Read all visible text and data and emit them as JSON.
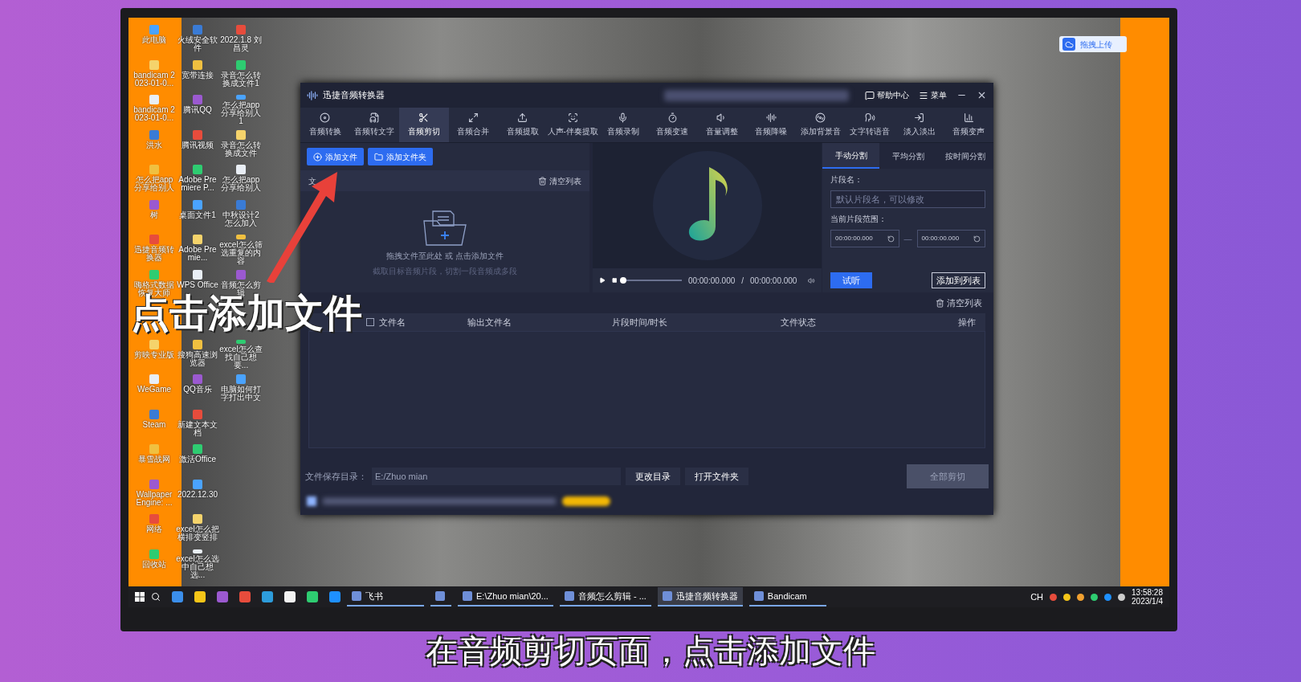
{
  "desktop": {
    "icon_columns": [
      [
        {
          "kind": "icon",
          "label": "此电脑"
        },
        {
          "kind": "icon",
          "label": "bandicam 2023-01-0..."
        },
        {
          "kind": "icon",
          "label": "bandicam 2023-01-0..."
        },
        {
          "kind": "icon",
          "label": "洪水"
        },
        {
          "kind": "icon",
          "label": "怎么把app分享给别人"
        },
        {
          "kind": "icon",
          "label": "树"
        },
        {
          "kind": "icon",
          "label": "迅捷音频转换器"
        },
        {
          "kind": "icon",
          "label": "嗨格式数据恢复大师"
        },
        {
          "kind": "covered"
        },
        {
          "kind": "icon",
          "label": "剪映专业版"
        },
        {
          "kind": "icon",
          "label": "WeGame"
        },
        {
          "kind": "icon",
          "label": "Steam"
        },
        {
          "kind": "icon",
          "label": "暴雪战网"
        },
        {
          "kind": "icon",
          "label": "Wallpaper Engine: ..."
        },
        {
          "kind": "icon",
          "label": "网络"
        },
        {
          "kind": "icon",
          "label": "回收站"
        }
      ],
      [
        {
          "kind": "icon",
          "label": "火绒安全软件"
        },
        {
          "kind": "icon",
          "label": "宽带连接"
        },
        {
          "kind": "icon",
          "label": "腾讯QQ"
        },
        {
          "kind": "icon",
          "label": "腾讯视频"
        },
        {
          "kind": "icon",
          "label": "Adobe Premiere P..."
        },
        {
          "kind": "icon",
          "label": "桌面文件1"
        },
        {
          "kind": "icon",
          "label": "Adobe Premie..."
        },
        {
          "kind": "icon",
          "label": "WPS Office"
        },
        {
          "kind": "covered"
        },
        {
          "kind": "icon",
          "label": "搜狗高速浏览器"
        },
        {
          "kind": "icon",
          "label": "QQ音乐"
        },
        {
          "kind": "icon",
          "label": "新建文本文档"
        },
        {
          "kind": "icon",
          "label": "激活Office"
        },
        {
          "kind": "icon",
          "label": "2022.12.30"
        },
        {
          "kind": "icon",
          "label": "excel怎么把横排变竖排"
        },
        {
          "kind": "icon",
          "label": "excel怎么选中自己想选..."
        }
      ],
      [
        {
          "kind": "icon",
          "label": "2022.1.8 刘昌灵"
        },
        {
          "kind": "icon",
          "label": "录音怎么转换成文件1"
        },
        {
          "kind": "icon",
          "label": "怎么把app分享给别人1"
        },
        {
          "kind": "icon",
          "label": "录音怎么转换成文件"
        },
        {
          "kind": "icon",
          "label": "怎么把app分享给别人"
        },
        {
          "kind": "icon",
          "label": "中秋设计2怎么加入"
        },
        {
          "kind": "icon",
          "label": "excel怎么筛选重复的内容"
        },
        {
          "kind": "icon",
          "label": "音频怎么剪辑"
        },
        {
          "kind": "covered"
        },
        {
          "kind": "icon",
          "label": "excel怎么查找自己想要..."
        },
        {
          "kind": "icon",
          "label": "电脑如何打字打出中文"
        }
      ]
    ]
  },
  "upload_button": {
    "label": "拖拽上传"
  },
  "app_window": {
    "title": "迅捷音频转换器",
    "help": "帮助中心",
    "menu": "菜单",
    "tools": [
      {
        "label": "音频转换",
        "selected": false
      },
      {
        "label": "音频转文字",
        "selected": false
      },
      {
        "label": "音频剪切",
        "selected": true
      },
      {
        "label": "音频合并",
        "selected": false
      },
      {
        "label": "音频提取",
        "selected": false
      },
      {
        "label": "人声-伴奏提取",
        "selected": false
      },
      {
        "label": "音频录制",
        "selected": false
      },
      {
        "label": "音频变速",
        "selected": false
      },
      {
        "label": "音量调整",
        "selected": false
      },
      {
        "label": "音频降噪",
        "selected": false
      },
      {
        "label": "添加背景音",
        "selected": false
      },
      {
        "label": "文字转语音",
        "selected": false
      },
      {
        "label": "淡入淡出",
        "selected": false
      },
      {
        "label": "音频变声",
        "selected": false
      }
    ],
    "add_file": "添加文件",
    "add_folder": "添加文件夹",
    "file_list_header": "文",
    "clear_list": "清空列表",
    "drop_hint": "拖拽文件至此处 或 点击添加文件",
    "drop_subhint": "截取目标音频片段，切割一段音频成多段",
    "player": {
      "level": 0,
      "current": "00:00:00.000",
      "separator": "/",
      "total": "00:00:00.000",
      "preview": "试听",
      "add_to_list": "添加到列表"
    },
    "split_tabs": [
      {
        "label": "手动分割",
        "selected": true
      },
      {
        "label": "平均分割",
        "selected": false
      },
      {
        "label": "按时间分割",
        "selected": false
      }
    ],
    "segment_name_label": "片段名：",
    "segment_name_placeholder": "默认片段名，可以修改",
    "range_label": "当前片段范围：",
    "range_start": "00:00:00.000",
    "range_dash": "—",
    "range_end": "00:00:00.000",
    "table": {
      "clear_list": "清空列表",
      "select_all_checked": false,
      "columns": [
        "文件名",
        "输出文件名",
        "片段时间/时长",
        "文件状态",
        "操作"
      ]
    },
    "save_dir_label": "文件保存目录：",
    "save_dir_value": "E:/Zhuo mian",
    "change_dir": "更改目录",
    "open_folder": "打开文件夹",
    "cut_all": {
      "label": "全部剪切",
      "disabled": true
    }
  },
  "caption": "点击添加文件",
  "taskbar": {
    "tasks": [
      {
        "label": "飞书",
        "selected": false
      },
      {
        "selected": false
      },
      {
        "label": "E:\\Zhuo mian\\20...",
        "selected": false
      },
      {
        "label": "音频怎么剪辑 - ...",
        "selected": false
      },
      {
        "label": "迅捷音频转换器",
        "selected": true
      },
      {
        "label": "Bandicam",
        "selected": false
      }
    ],
    "input_indicator": "CH",
    "time": "13:58:28",
    "date": "2023/1/4"
  },
  "subtitle": "在音频剪切页面，点击添加文件"
}
